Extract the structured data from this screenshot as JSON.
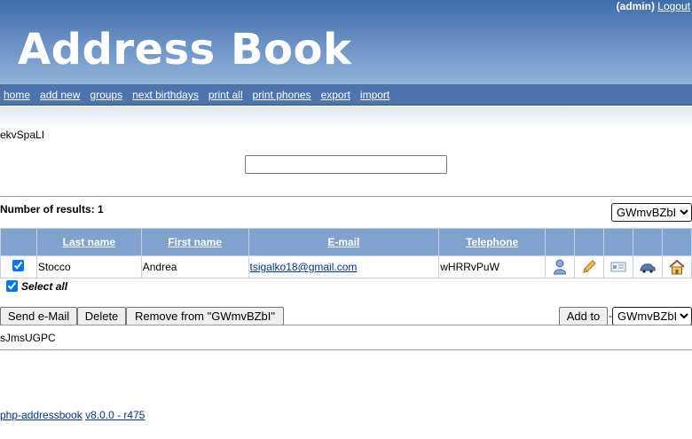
{
  "header": {
    "user": "(admin)",
    "logout": "Logout",
    "logo": "Address Book"
  },
  "nav": [
    "home",
    "add new",
    "groups",
    "next birthdays",
    "print all",
    "print phones",
    "export",
    "import"
  ],
  "group_name": "ekvSpaLI",
  "search": {
    "value": "",
    "placeholder": ""
  },
  "results": {
    "label": "Number of results:",
    "count": "1"
  },
  "group_select_top": {
    "selected": "GWmvBZbI"
  },
  "table": {
    "columns": [
      "Last name",
      "First name",
      "E-mail",
      "Telephone"
    ],
    "rows": [
      {
        "selected": true,
        "last_name": "Stocco",
        "first_name": "Andrea",
        "email": "tsigalko18@gmail.com",
        "telephone": "wHRRvPuW",
        "icons": [
          "person-icon",
          "pencil-edit-icon",
          "vcard-icon",
          "car-icon",
          "home-icon"
        ]
      }
    ]
  },
  "select_all": {
    "label": "Select all",
    "checked": true
  },
  "actions": {
    "send_email": "Send e-Mail",
    "delete": "Delete",
    "remove": "Remove from \"GWmvBZbI\"",
    "add_to": "Add to",
    "dash": "-",
    "group_select_bottom": "GWmvBZbI"
  },
  "footer_group": "sJmsUGPC",
  "footer": {
    "app_link": "php-addressbook",
    "version_link": "v8.0.0 - r475"
  }
}
